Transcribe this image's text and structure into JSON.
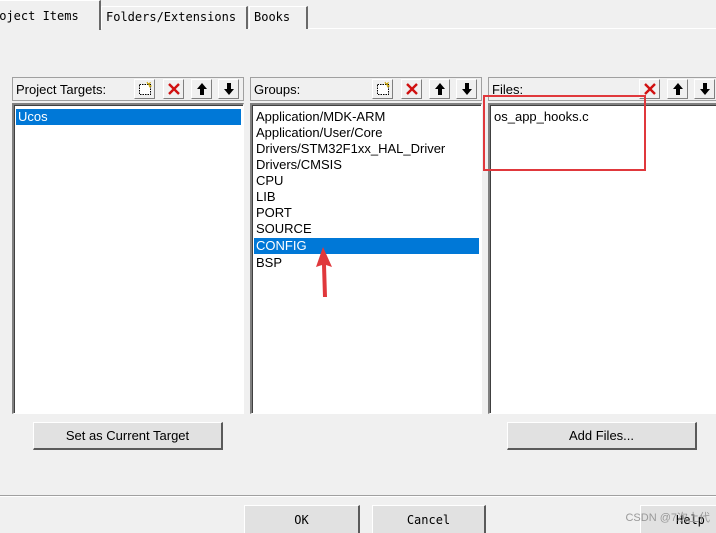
{
  "tabs": [
    {
      "label": "roject Items",
      "active": true
    },
    {
      "label": "Folders/Extensions",
      "active": false
    },
    {
      "label": "Books",
      "active": false
    }
  ],
  "targets_panel": {
    "title": "Project Targets:",
    "items": [
      "Ucos"
    ],
    "selected_index": 0,
    "toolbar_icons": [
      "new-icon",
      "delete-icon",
      "move-up-icon",
      "move-down-icon"
    ]
  },
  "groups_panel": {
    "title": "Groups:",
    "items": [
      "Application/MDK-ARM",
      "Application/User/Core",
      "Drivers/STM32F1xx_HAL_Driver",
      "Drivers/CMSIS",
      "CPU",
      "LIB",
      "PORT",
      "SOURCE",
      "CONFIG",
      "BSP"
    ],
    "selected_index": 8,
    "toolbar_icons": [
      "new-icon",
      "delete-icon",
      "move-up-icon",
      "move-down-icon"
    ]
  },
  "files_panel": {
    "title": "Files:",
    "items": [
      "os_app_hooks.c"
    ],
    "toolbar_icons": [
      "delete-icon",
      "move-up-icon",
      "move-down-icon"
    ]
  },
  "buttons": {
    "set_current_target": "Set as Current Target",
    "add_files": "Add Files...",
    "ok": "OK",
    "cancel": "Cancel",
    "help": "Help"
  },
  "watermark": "CSDN @7次上代",
  "colors": {
    "selection": "#0078d7",
    "annotation": "#e0383c",
    "dialog_bg": "#f0f0f0"
  }
}
